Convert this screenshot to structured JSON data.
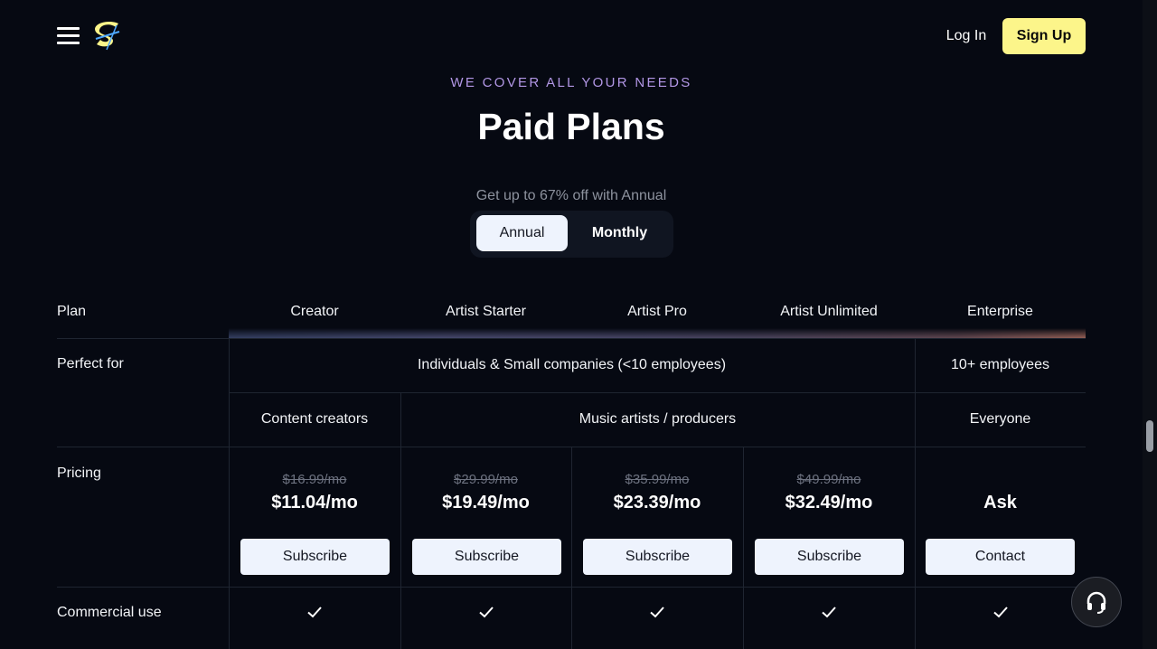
{
  "header": {
    "menu_icon": "hamburger-icon",
    "logo_icon": "logo-s-icon",
    "login_label": "Log In",
    "signup_label": "Sign Up",
    "signup_color": "#fcf58a"
  },
  "hero": {
    "eyebrow": "WE COVER ALL YOUR NEEDS",
    "title": "Paid Plans",
    "discount_note": "Get up to 67% off with Annual",
    "toggle": {
      "active": "Annual",
      "inactive": "Monthly"
    }
  },
  "table": {
    "plan_label": "Plan",
    "plans": [
      "Creator",
      "Artist Starter",
      "Artist Pro",
      "Artist Unlimited",
      "Enterprise"
    ],
    "perfect_for_label": "Perfect for",
    "audience_group": "Individuals & Small companies (<10 employees)",
    "audience_enterprise": "10+ employees",
    "sub_creator": "Content creators",
    "sub_music": "Music artists / producers",
    "sub_enterprise": "Everyone",
    "pricing_label": "Pricing",
    "prices": [
      {
        "old": "$16.99/mo",
        "new": "$11.04/mo",
        "button": "Subscribe"
      },
      {
        "old": "$29.99/mo",
        "new": "$19.49/mo",
        "button": "Subscribe"
      },
      {
        "old": "$35.99/mo",
        "new": "$23.39/mo",
        "button": "Subscribe"
      },
      {
        "old": "$49.99/mo",
        "new": "$32.49/mo",
        "button": "Subscribe"
      },
      {
        "old": "",
        "new": "Ask",
        "button": "Contact"
      }
    ],
    "commercial_label": "Commercial use",
    "check_icon": "checkmark-icon"
  },
  "support_icon": "headset-icon"
}
